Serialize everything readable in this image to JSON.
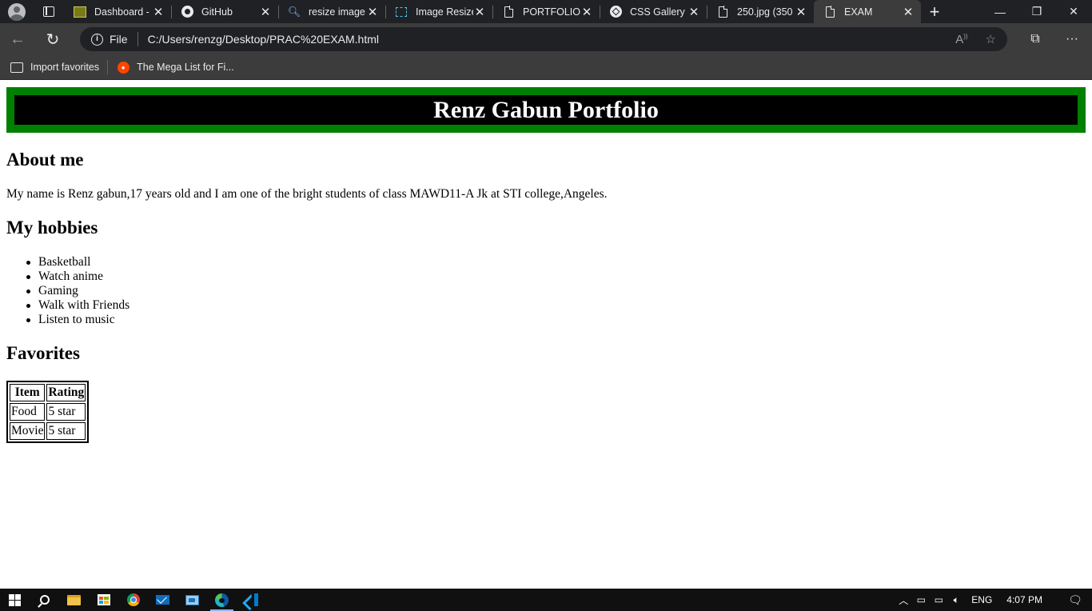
{
  "browser": {
    "tabs": [
      {
        "label": "Dashboard -",
        "icon": "dashboard-favicon"
      },
      {
        "label": "GitHub",
        "icon": "github-icon"
      },
      {
        "label": "resize image",
        "icon": "search-icon"
      },
      {
        "label": "Image Resize",
        "icon": "image-resizer-icon"
      },
      {
        "label": "PORTFOLIO",
        "icon": "page-icon"
      },
      {
        "label": "CSS Gallery",
        "icon": "css-gallery-icon"
      },
      {
        "label": "250.jpg (350",
        "icon": "page-icon"
      },
      {
        "label": "EXAM",
        "icon": "page-icon",
        "active": true
      }
    ],
    "address": {
      "scheme_label": "File",
      "url": "C:/Users/renzg/Desktop/PRAC%20EXAM.html"
    },
    "favorites": [
      {
        "label": "Import favorites",
        "icon": "import-favorites-icon"
      },
      {
        "label": "The Mega List for Fi...",
        "icon": "reddit-icon"
      }
    ]
  },
  "page": {
    "title": "Renz Gabun Portfolio",
    "about_heading": "About me",
    "about_text": "My name is Renz gabun,17 years old and I am one of the bright students of class MAWD11-A Jk at STI college,Angeles.",
    "hobbies_heading": "My hobbies",
    "hobbies": [
      "Basketball",
      "Watch anime",
      "Gaming",
      "Walk with Friends",
      "Listen to music"
    ],
    "favorites_heading": "Favorites",
    "favorites_table": {
      "headers": [
        "Item",
        "Rating"
      ],
      "rows": [
        [
          "Food",
          "5 star"
        ],
        [
          "Movie",
          "5 star"
        ]
      ]
    }
  },
  "taskbar": {
    "language": "ENG",
    "time": "4:07 PM"
  },
  "colors": {
    "banner_border": "#008000",
    "banner_bg": "#000000",
    "banner_text": "#ffffff"
  }
}
